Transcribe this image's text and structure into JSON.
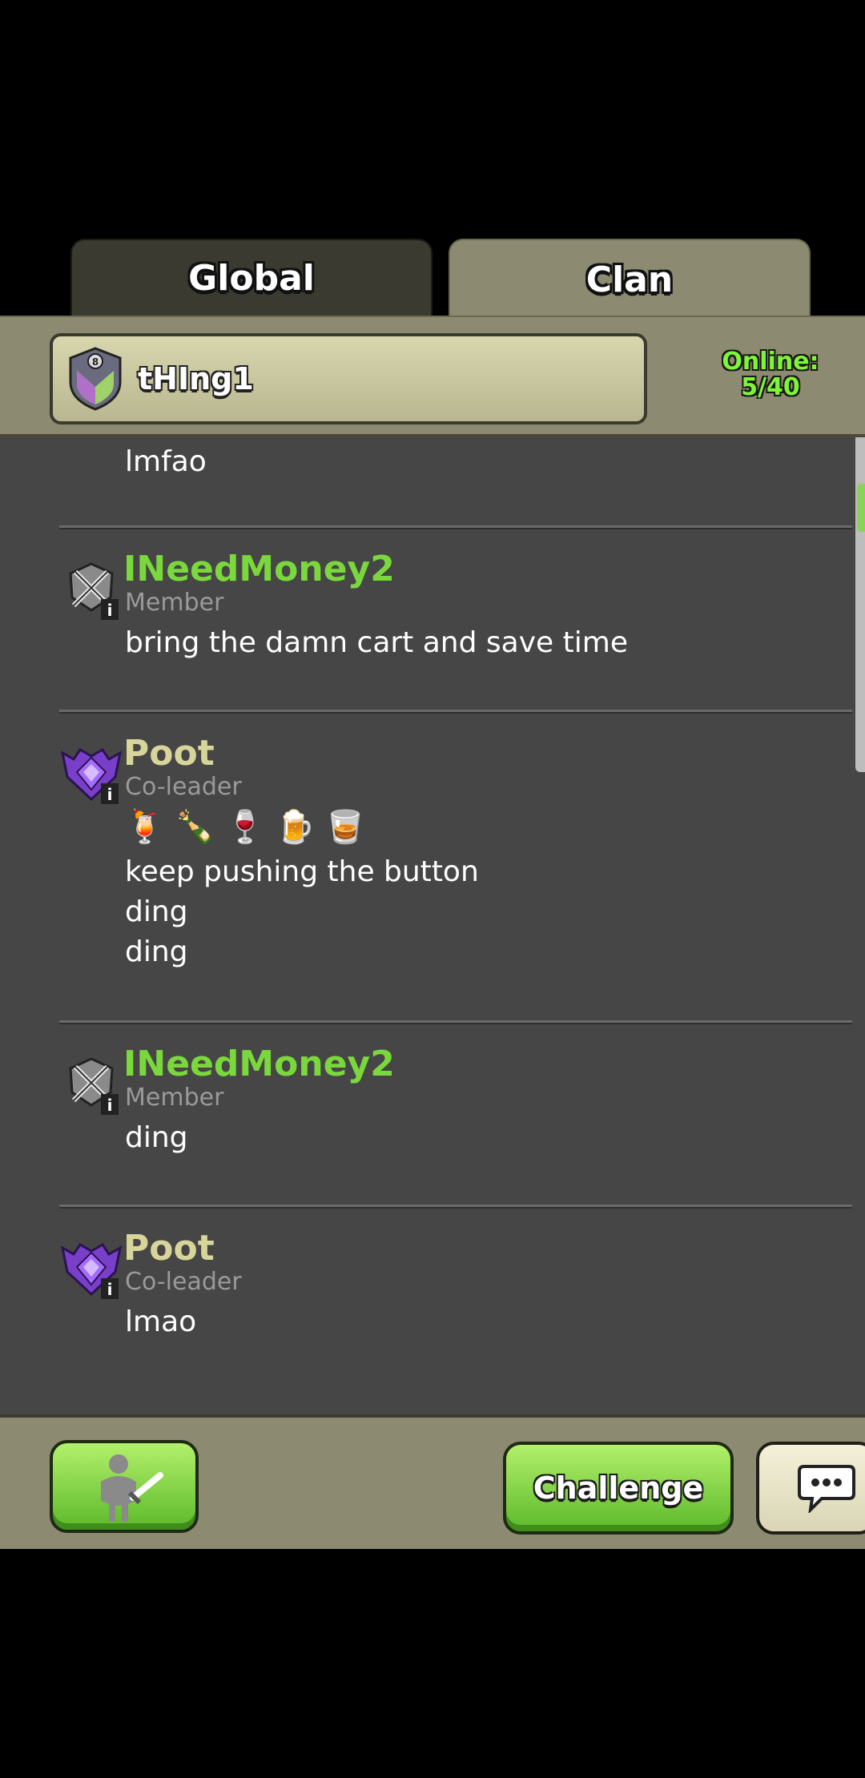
{
  "tabs": {
    "global": "Global",
    "clan": "Clan"
  },
  "header": {
    "clan_name": "tHIng1",
    "online_label": "Online:",
    "online_count": "5/40"
  },
  "chat": {
    "partial_message": "lmfao",
    "messages": [
      {
        "name": "INeedMoney2",
        "role": "Member",
        "lines": [
          "bring the damn cart and save time"
        ]
      },
      {
        "name": "Poot",
        "role": "Co-leader",
        "emoji": "🍹 🍾 🍷 🍺 🥃",
        "lines": [
          "keep pushing the button",
          "ding",
          "ding"
        ]
      },
      {
        "name": "INeedMoney2",
        "role": "Member",
        "lines": [
          "ding"
        ]
      },
      {
        "name": "Poot",
        "role": "Co-leader",
        "lines": [
          "lmao"
        ]
      }
    ]
  },
  "bottom": {
    "challenge_label": "Challenge"
  },
  "icons": {
    "clan_badge": "clan-badge-icon",
    "member_badge": "crossed-swords-icon",
    "coleader_badge": "purple-shield-icon",
    "troops": "warrior-sword-icon",
    "chat": "speech-bubble-icon"
  },
  "colors": {
    "member_name": "#7ad83c",
    "coleader_name": "#d8d59a",
    "online": "#7ff53a",
    "button_green": "#5cb92a"
  }
}
